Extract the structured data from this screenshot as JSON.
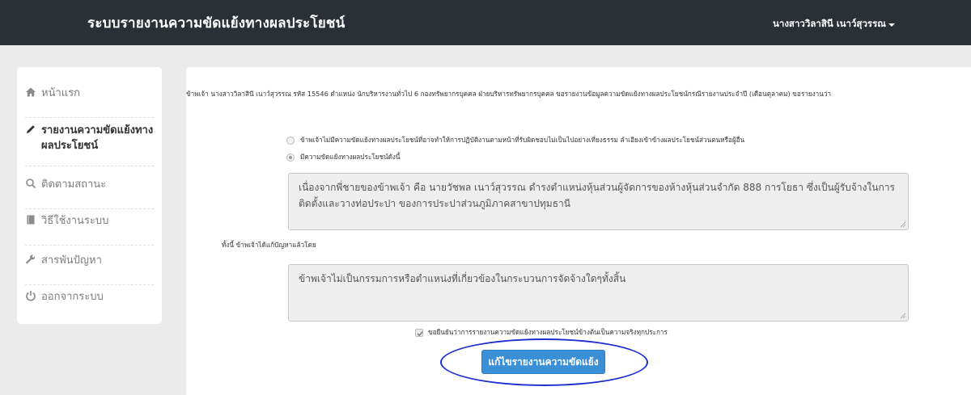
{
  "navbar": {
    "title": "ระบบรายงานความขัดแย้งทางผลประโยชน์",
    "user_name": "นางสาววิลาสินี เนาว์สุวรรณ"
  },
  "sidebar": {
    "items": [
      {
        "label": "หน้าแรก",
        "icon": "home-icon"
      },
      {
        "label": "รายงานความขัดแย้งทางผลประโยชน์",
        "icon": "pencil-icon"
      },
      {
        "label": "ติดตามสถานะ",
        "icon": "search-icon"
      },
      {
        "label": "วิธีใช้งานระบบ",
        "icon": "book-icon"
      },
      {
        "label": "สารพันปัญหา",
        "icon": "wrench-icon"
      },
      {
        "label": "ออกจากระบบ",
        "icon": "power-icon"
      }
    ]
  },
  "main": {
    "intro_text": "ข้าพเจ้า นางสาววิลาสินี เนาว์สุวรรณ รหัส 15546 ตำแหน่ง นักบริหารงานทั่วไป 6 กองทรัพยากรบุคคล ฝ่ายบริหารทรัพยากรบุคคล ขอรายงานข้อมูลความขัดแย้งทางผลประโยชน์กรณีรายงานประจำปี (เดือนตุลาคม) ขอรายงานว่า",
    "option_no_conflict": "ข้าพเจ้าไม่มีความขัดแย้งทางผลประโยชน์ที่อาจทำให้การปฏิบัติงานตามหน้าที่รับผิดชอบไม่เป็นไปอย่างเที่ยงธรรม ลำเอียงเข้าข้างผลประโยชน์ส่วนตนหรือผู้อื่น",
    "option_has_conflict": "มีความขัดแย้งทางผลประโยชน์ดังนี้",
    "conflict_detail": "เนื่องจากพี่ชายของข้าพเจ้า คือ นายวัชพล เนาว์สุวรรณ ดำรงตำแหน่งหุ้นส่วนผู้จัดการของห้างหุ้นส่วนจำกัด 888 การโยธา ซึ่งเป็นผู้รับจ้างในการติดตั้งและวางท่อประปา ของการประปาส่วนภูมิภาคสาขาปทุมธานี",
    "resolution_label": "ทั้งนี้ ข้าพเจ้าได้แก้ปัญหาแล้วโดย",
    "resolution_detail": "ข้าพเจ้าไม่เป็นกรรมการหรือตำแหน่งที่เกี่ยวข้องในกระบวนการจัดจ้างใดๆทั้งสิ้น",
    "confirm_text": "ขอยืนยันว่าการรายงานความขัดแย้งทางผลประโยชน์ข้างต้นเป็นความจริงทุกประการ",
    "edit_button": "แก้ไขรายงานความขัดแย้ง"
  },
  "colors": {
    "navbar_bg": "#2b3036",
    "button_blue": "#3a8fd6",
    "annotation_ellipse": "#1d2fd1"
  }
}
